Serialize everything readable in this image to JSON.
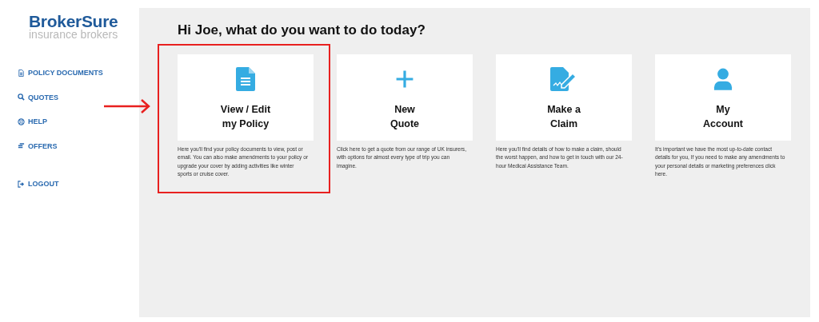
{
  "logo": {
    "name": "BrokerSure",
    "tagline": "insurance brokers"
  },
  "nav": [
    {
      "label": "POLICY DOCUMENTS",
      "kind": "document"
    },
    {
      "label": "QUOTES",
      "kind": "search"
    },
    {
      "label": "HELP",
      "kind": "help"
    },
    {
      "label": "OFFERS",
      "kind": "offers"
    },
    {
      "label": "LOGOUT",
      "kind": "logout"
    }
  ],
  "heading": "Hi Joe, what do you want to do today?",
  "cards": [
    {
      "kind": "document",
      "title": [
        "View / Edit",
        "my Policy"
      ],
      "highlighted": true,
      "description": "Here you'll find your policy documents to view, post or email. You can also make amendments to your policy or upgrade your cover by adding activities like winter sports or cruise cover."
    },
    {
      "kind": "plus",
      "title": [
        "New",
        "Quote"
      ],
      "highlighted": false,
      "description": "Click here to get a quote from our range of UK insurers, with options for almost every type of trip you can imagine."
    },
    {
      "kind": "claim",
      "title": [
        "Make a",
        "Claim"
      ],
      "highlighted": false,
      "description": "Here you'll find details of how to make a claim, should the worst happen, and how to get in touch with our 24-hour Medical Assistance Team."
    },
    {
      "kind": "person",
      "title": [
        "My",
        "Account"
      ],
      "highlighted": false,
      "description": "It's important we have the most up-to-date contact details for you, If you need to make any amendments to your personal details or marketing preferences click here."
    }
  ]
}
